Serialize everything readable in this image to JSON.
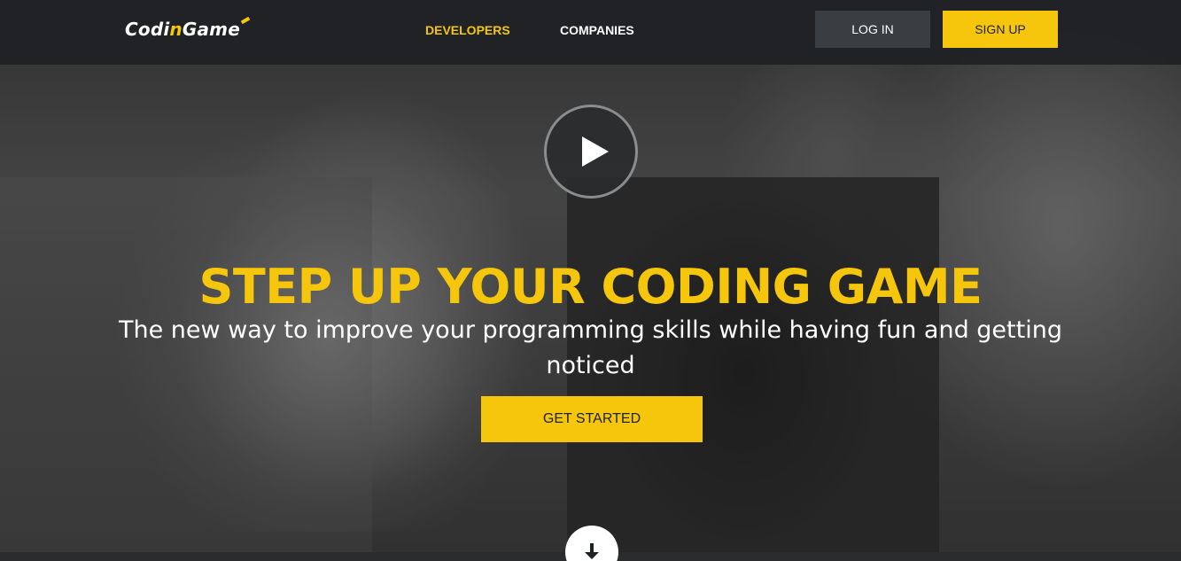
{
  "header": {
    "logo": {
      "part_a": "Codi",
      "part_b": "n",
      "part_c": "Game"
    },
    "nav": [
      {
        "label": "DEVELOPERS",
        "active": true
      },
      {
        "label": "COMPANIES",
        "active": false
      }
    ],
    "login_label": "LOG IN",
    "signup_label": "SIGN UP"
  },
  "hero": {
    "play_icon": "play-icon",
    "title": "STEP UP YOUR CODING GAME",
    "subtitle": "The new way to improve your programming skills while having fun and getting noticed",
    "cta_label": "GET STARTED",
    "scroll_icon": "arrow-down-icon"
  },
  "colors": {
    "accent": "#f5c60b",
    "header_bg": "#1e2124",
    "login_bg": "#3a3d41",
    "text_light": "#ffffff"
  }
}
